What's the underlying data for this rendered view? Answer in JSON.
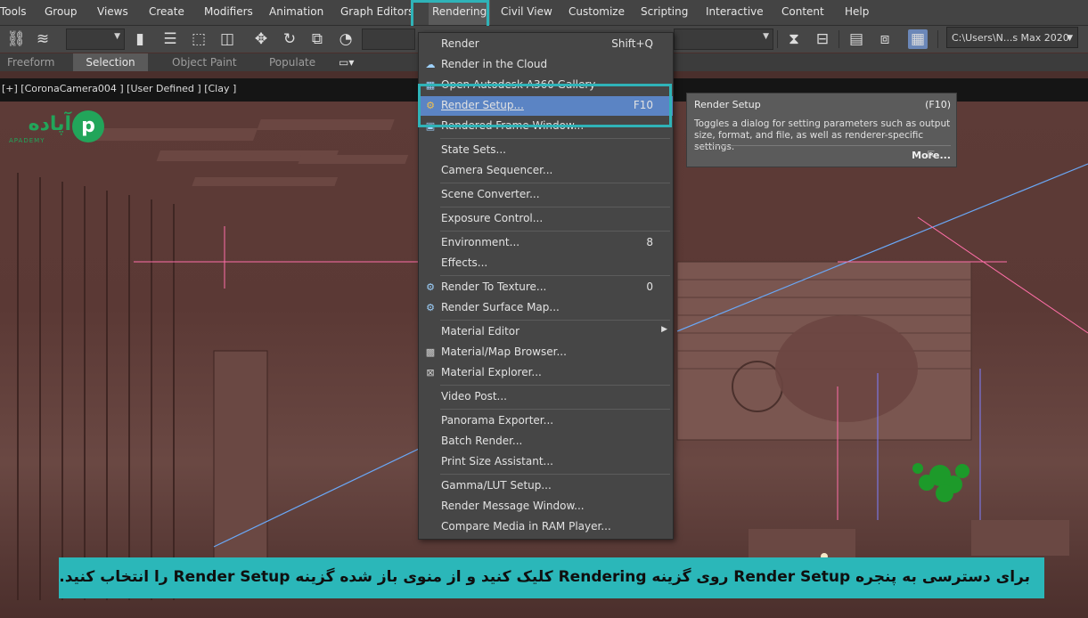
{
  "menubar": {
    "items": [
      "Tools",
      "Group",
      "Views",
      "Create",
      "Modifiers",
      "Animation",
      "Graph Editors",
      "Rendering",
      "Civil View",
      "Customize",
      "Scripting",
      "Interactive",
      "Content",
      "Help"
    ]
  },
  "toolbar": {
    "path": "C:\\Users\\N...s Max 2020"
  },
  "ribbon": {
    "tabs": [
      "Freeform",
      "Selection",
      "Object Paint",
      "Populate"
    ],
    "active": "Selection"
  },
  "viewport": {
    "label": "[+] [CoronaCamera004 ] [User Defined ] [Clay ]"
  },
  "logo": {
    "text": "آپاده",
    "sub": "APADEMY"
  },
  "rendering_menu": {
    "items": [
      {
        "label": "Render",
        "shortcut": "Shift+Q"
      },
      {
        "label": "Render in the Cloud",
        "shortcut": ""
      },
      {
        "label": "Open Autodesk A360 Gallery",
        "shortcut": ""
      },
      {
        "label": "Render Setup...",
        "shortcut": "F10"
      },
      {
        "label": "Rendered Frame Window...",
        "shortcut": ""
      },
      {
        "label": "State Sets...",
        "shortcut": ""
      },
      {
        "label": "Camera Sequencer...",
        "shortcut": ""
      },
      {
        "label": "Scene Converter...",
        "shortcut": ""
      },
      {
        "label": "Exposure Control...",
        "shortcut": ""
      },
      {
        "label": "Environment...",
        "shortcut": "8"
      },
      {
        "label": "Effects...",
        "shortcut": ""
      },
      {
        "label": "Render To Texture...",
        "shortcut": "0"
      },
      {
        "label": "Render Surface Map...",
        "shortcut": ""
      },
      {
        "label": "Material Editor",
        "shortcut": ""
      },
      {
        "label": "Material/Map Browser...",
        "shortcut": ""
      },
      {
        "label": "Material Explorer...",
        "shortcut": ""
      },
      {
        "label": "Video Post...",
        "shortcut": ""
      },
      {
        "label": "Panorama Exporter...",
        "shortcut": ""
      },
      {
        "label": "Batch Render...",
        "shortcut": ""
      },
      {
        "label": "Print Size Assistant...",
        "shortcut": ""
      },
      {
        "label": "Gamma/LUT Setup...",
        "shortcut": ""
      },
      {
        "label": "Render Message Window...",
        "shortcut": ""
      },
      {
        "label": "Compare Media in RAM Player...",
        "shortcut": ""
      }
    ]
  },
  "tooltip": {
    "title": "Render Setup",
    "shortcut": "(F10)",
    "description": "Toggles a dialog for setting parameters such as output size, format, and file, as well as renderer-specific settings.",
    "more": "More..."
  },
  "banner": {
    "text": "برای دسترسی به پنجره Render Setup روی گزینه Rendering کلیک کنید و از منوی باز شده گزینه Render Setup را انتخاب کنید."
  },
  "colors": {
    "menu_highlight": "#5b84c4",
    "callout": "#2fb3b8",
    "banner": "#2bb7b9",
    "logo": "#22a55a"
  }
}
